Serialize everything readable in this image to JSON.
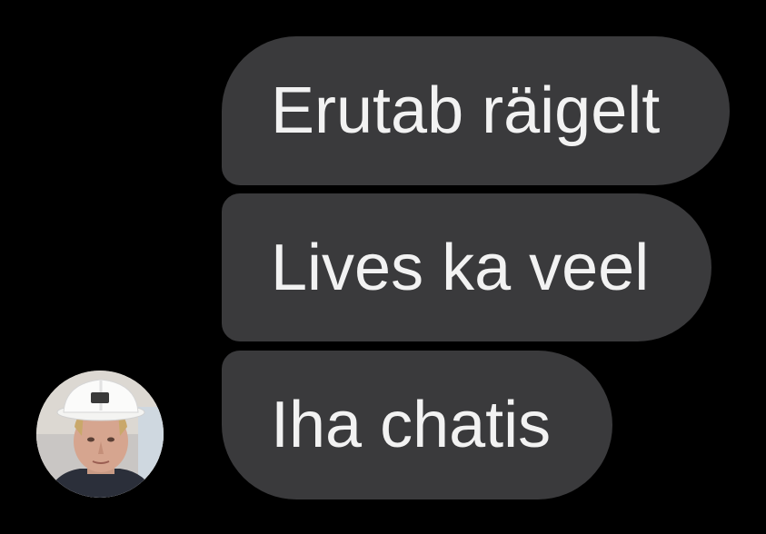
{
  "conversation": {
    "messages": [
      {
        "text": "Erutab räigelt"
      },
      {
        "text": "Lives ka veel"
      },
      {
        "text": "Iha chatis"
      }
    ]
  },
  "colors": {
    "background": "#000000",
    "bubble": "#3a3a3c",
    "bubble_text": "#f2f2f2"
  },
  "avatar": {
    "icon": "person-in-hard-hat"
  }
}
